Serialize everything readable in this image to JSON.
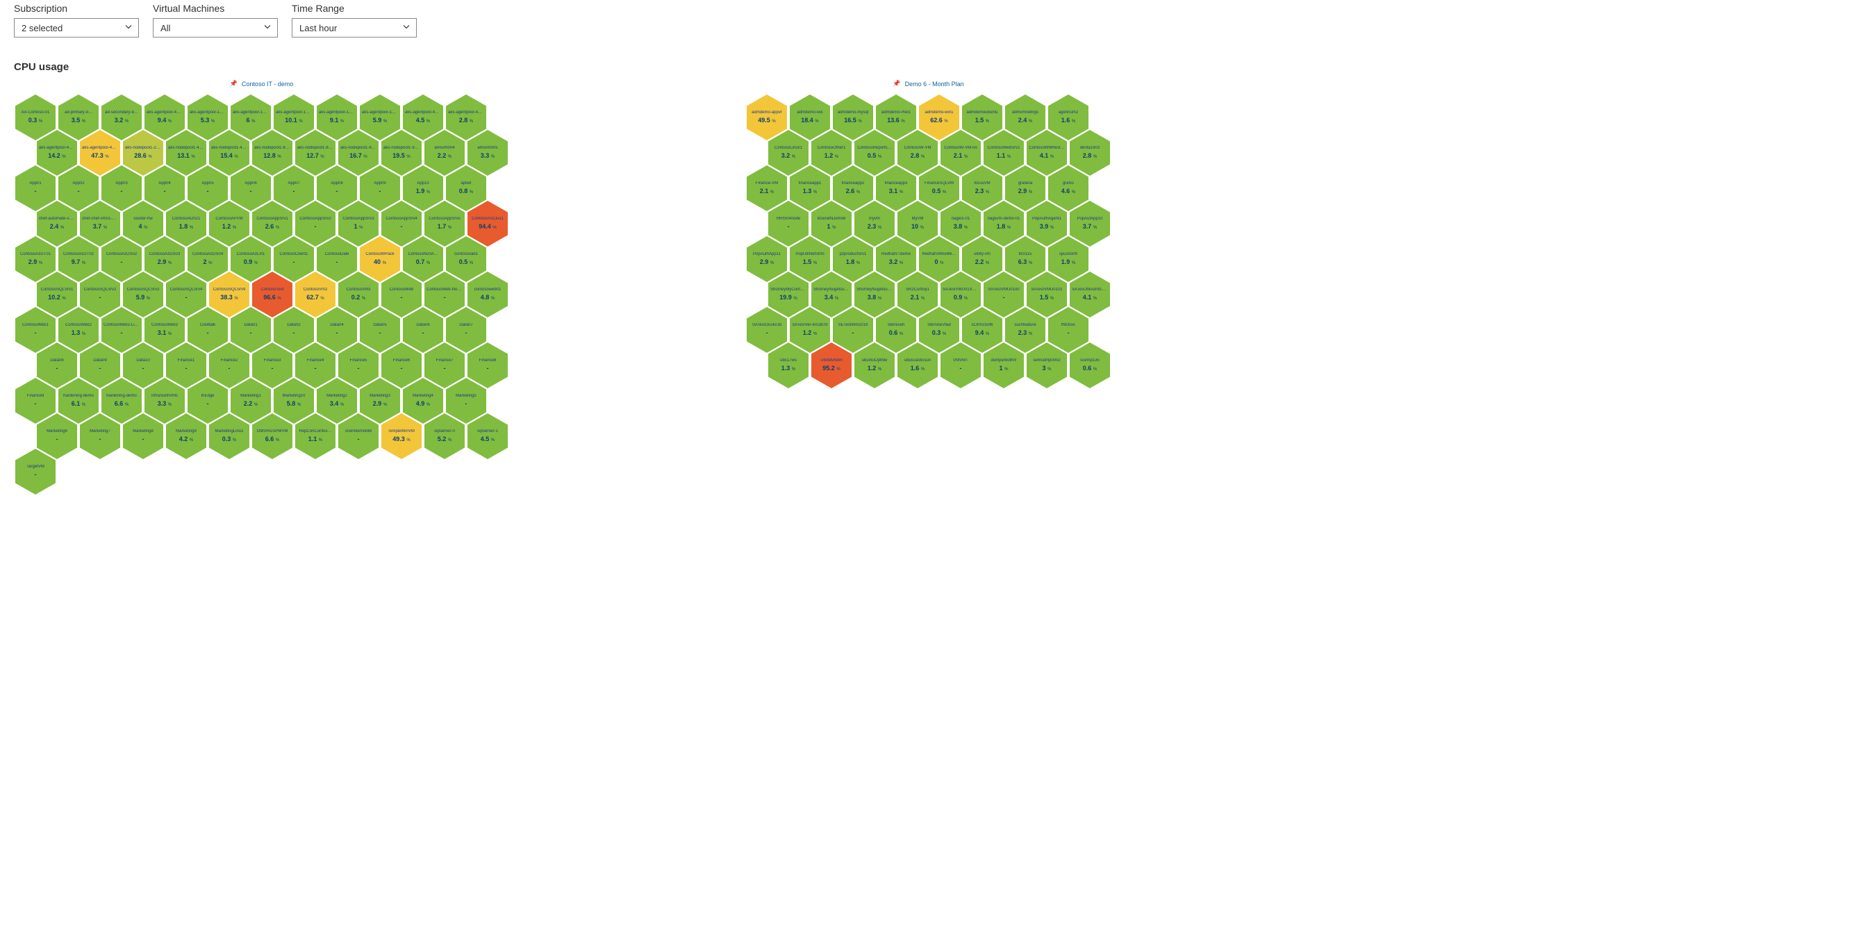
{
  "filters": {
    "subscription": {
      "label": "Subscription",
      "value": "2 selected"
    },
    "vms": {
      "label": "Virtual Machines",
      "value": "All"
    },
    "timerange": {
      "label": "Time Range",
      "value": "Last hour"
    }
  },
  "panel": {
    "title": "CPU usage"
  },
  "thresholds": {
    "green": "#80bc3f",
    "yellow": "#f3c63a",
    "orange": "#e87a2a",
    "red": "#e85b2e"
  },
  "clusters": [
    {
      "title": "Contoso IT - demo",
      "rows": [
        [
          {
            "name": "AA-Contoso-01",
            "value": "0.3"
          },
          {
            "name": "ad-primary-d…",
            "value": "3.5"
          },
          {
            "name": "ad-secondary-d…",
            "value": "3.2"
          },
          {
            "name": "aks-agentpool-40719…",
            "value": "9.4"
          },
          {
            "name": "aks-agentpool-14131…",
            "value": "5.3"
          },
          {
            "name": "aks-agentpool-14132…",
            "value": "6"
          },
          {
            "name": "aks-agentpool-14830…",
            "value": "10.1"
          },
          {
            "name": "aks-agentpool-18040…",
            "value": "9.1"
          },
          {
            "name": "aks-agentpool-18040…",
            "value": "5.9"
          },
          {
            "name": "aks-agentpool-40718…",
            "value": "4.5"
          },
          {
            "name": "aks-agentpool-40718…",
            "value": "2.8"
          }
        ],
        [
          {
            "name": "aks-agentpool-40719…",
            "value": "14.2"
          },
          {
            "name": "aks-agentpool-40719…",
            "value": "47.3",
            "color": "yellow"
          },
          {
            "name": "aks-nodepool1-2549…",
            "value": "28.6"
          },
          {
            "name": "aks-nodepool1-4281…",
            "value": "13.1"
          },
          {
            "name": "aks-nodepool1-4281…",
            "value": "15.4"
          },
          {
            "name": "aks-nodepool1-8538…",
            "value": "12.8"
          },
          {
            "name": "aks-nodepool1-8538…",
            "value": "12.7"
          },
          {
            "name": "aks-nodepool1-8538…",
            "value": "16.7"
          },
          {
            "name": "aks-nodepool1-9520…",
            "value": "19.5"
          },
          {
            "name": "amsvm004",
            "value": "2.2"
          },
          {
            "name": "amsvm005",
            "value": "3.3"
          }
        ],
        [
          {
            "name": "App01",
            "value": null
          },
          {
            "name": "App02",
            "value": null
          },
          {
            "name": "App03",
            "value": null
          },
          {
            "name": "App04",
            "value": null
          },
          {
            "name": "App05",
            "value": null
          },
          {
            "name": "App06",
            "value": null
          },
          {
            "name": "App07",
            "value": null
          },
          {
            "name": "App08",
            "value": null
          },
          {
            "name": "App09",
            "value": null
          },
          {
            "name": "App10",
            "value": "1.9"
          },
          {
            "name": "apted",
            "value": "0.8"
          }
        ],
        [
          {
            "name": "chef-automate-vm01",
            "value": "2.4"
          },
          {
            "name": "chef-chef-vm01-VM",
            "value": "3.7"
          },
          {
            "name": "cluster-hw",
            "value": "4"
          },
          {
            "name": "ContosoAD021",
            "value": "1.8"
          },
          {
            "name": "ContosoAPVM",
            "value": "1.2"
          },
          {
            "name": "ContosoAppSrv1",
            "value": "2.6"
          },
          {
            "name": "ContosoAppSrv2",
            "value": null
          },
          {
            "name": "ContosoAppSrv3",
            "value": "1"
          },
          {
            "name": "ContosoAppSrv4",
            "value": null
          },
          {
            "name": "ContosoAppSrv5",
            "value": "1.7"
          },
          {
            "name": "ContosoASClus1",
            "value": "94.4",
            "color": "red"
          }
        ],
        [
          {
            "name": "ContosoAzDT01",
            "value": "2.9"
          },
          {
            "name": "ContosoAzDT02",
            "value": "9.7"
          },
          {
            "name": "ContosoAzDS02",
            "value": null
          },
          {
            "name": "ContosoAzDS03",
            "value": "2.9"
          },
          {
            "name": "ContosoAzDS04",
            "value": "2"
          },
          {
            "name": "ContosoAzLin1",
            "value": "0.9"
          },
          {
            "name": "ContosoClient1",
            "value": null
          },
          {
            "name": "ContosoDale",
            "value": null
          },
          {
            "name": "ContosoWPack",
            "value": "40",
            "color": "yellow"
          },
          {
            "name": "ContosoNoSn…",
            "value": "0.7"
          },
          {
            "name": "contosovab1",
            "value": "0.5"
          }
        ],
        [
          {
            "name": "ContosoSQLSrv1",
            "value": "10.2"
          },
          {
            "name": "ContosoSQLSrv2",
            "value": null
          },
          {
            "name": "ContosoSQLSrv3",
            "value": "5.9"
          },
          {
            "name": "ContosoSQLSrv4",
            "value": null
          },
          {
            "name": "ContosoSQLSrv9",
            "value": "38.3",
            "color": "yellow"
          },
          {
            "name": "ContosoTest",
            "value": "96.6",
            "color": "red"
          },
          {
            "name": "ContosoVm2",
            "value": "62.7",
            "color": "yellow"
          },
          {
            "name": "ContosoVM3",
            "value": "0.2"
          },
          {
            "name": "ContosoWeb",
            "value": null
          },
          {
            "name": "ContosoWeb-NoState",
            "value": null
          },
          {
            "name": "contosoweb01",
            "value": "4.8"
          }
        ],
        [
          {
            "name": "ContosoWeb1",
            "value": null
          },
          {
            "name": "ContosoWeb2",
            "value": "1.3"
          },
          {
            "name": "ContosoWeb2-Linux",
            "value": null
          },
          {
            "name": "ContosoWeb3",
            "value": "3.1"
          },
          {
            "name": "Cre8talk",
            "value": null
          },
          {
            "name": "Data01",
            "value": null
          },
          {
            "name": "Data02",
            "value": null
          },
          {
            "name": "Data04",
            "value": null
          },
          {
            "name": "Data05",
            "value": null
          },
          {
            "name": "Data06",
            "value": null
          },
          {
            "name": "Data07",
            "value": null
          }
        ],
        [
          {
            "name": "Data08",
            "value": null
          },
          {
            "name": "Data09",
            "value": null
          },
          {
            "name": "Data10",
            "value": null
          },
          {
            "name": "Finance1",
            "value": null
          },
          {
            "name": "Finance2",
            "value": null
          },
          {
            "name": "Finance3",
            "value": null
          },
          {
            "name": "Finance4",
            "value": null
          },
          {
            "name": "Finance5",
            "value": null
          },
          {
            "name": "Finance6",
            "value": null
          },
          {
            "name": "Finance7",
            "value": null
          },
          {
            "name": "Finance8",
            "value": null
          }
        ],
        [
          {
            "name": "Finance9",
            "value": null
          },
          {
            "name": "hardening-demo",
            "value": "6.1"
          },
          {
            "name": "hardening-demo",
            "value": "6.6"
          },
          {
            "name": "InfraSubhVMs",
            "value": "3.3"
          },
          {
            "name": "InEdge",
            "value": null
          },
          {
            "name": "Marketing1",
            "value": "2.2"
          },
          {
            "name": "Marketing10",
            "value": "5.8"
          },
          {
            "name": "Marketing2",
            "value": "3.4"
          },
          {
            "name": "Marketing3",
            "value": "2.9"
          },
          {
            "name": "Marketing4",
            "value": "4.9"
          },
          {
            "name": "Marketing5",
            "value": null
          }
        ],
        [
          {
            "name": "Marketing6",
            "value": null
          },
          {
            "name": "Marketing7",
            "value": null
          },
          {
            "name": "Marketing8",
            "value": null
          },
          {
            "name": "Marketing9",
            "value": "4.2"
          },
          {
            "name": "MarketingLinu1",
            "value": "0.3"
          },
          {
            "name": "OMSRGSPMVM",
            "value": "6.6"
          },
          {
            "name": "RepConContos…",
            "value": "1.1"
          },
          {
            "name": "scemdemoMB",
            "value": null
          },
          {
            "name": "SimpleWinVM",
            "value": "49.3",
            "color": "yellow"
          },
          {
            "name": "sqlserver-0",
            "value": "5.2"
          },
          {
            "name": "sqlserver-1",
            "value": "4.5"
          }
        ],
        [
          {
            "name": "TargetVM",
            "value": null
          }
        ]
      ]
    },
    {
      "title": "Demo 6 - Month Plan",
      "rows": [
        [
          {
            "name": "admdemo-appvr",
            "value": "49.5",
            "color": "yellow"
          },
          {
            "name": "admdemo-iws",
            "value": "18.4"
          },
          {
            "name": "admdemo-mysql",
            "value": "16.5"
          },
          {
            "name": "admdemo-rhel1",
            "value": "13.6"
          },
          {
            "name": "admdemo-win1",
            "value": "62.6",
            "color": "yellow"
          },
          {
            "name": "admdemoubuntu",
            "value": "1.5"
          },
          {
            "name": "admvmredirgs",
            "value": "2.4"
          },
          {
            "name": "agennum2",
            "value": "1.6"
          }
        ],
        [
          {
            "name": "ContosoLinux1",
            "value": "3.2"
          },
          {
            "name": "ContosoOther1",
            "value": "1.2"
          },
          {
            "name": "ContosoReports…",
            "value": "0.5"
          },
          {
            "name": "ContosoW-VM",
            "value": "2.8"
          },
          {
            "name": "ContosoW-VM-no",
            "value": "2.1"
          },
          {
            "name": "ContosoWebSrv1",
            "value": "1.1"
          },
          {
            "name": "ContosoWMRest…",
            "value": "4.1"
          },
          {
            "name": "denta1903",
            "value": "2.8"
          }
        ],
        [
          {
            "name": "Finance-VM",
            "value": "2.1"
          },
          {
            "name": "financeapp1",
            "value": "1.3"
          },
          {
            "name": "financeapp2",
            "value": "2.6"
          },
          {
            "name": "financeapp3",
            "value": "3.1"
          },
          {
            "name": "FinanceSQLVM",
            "value": "0.5"
          },
          {
            "name": "focusVM",
            "value": "2.3"
          },
          {
            "name": "grafana",
            "value": "2.9"
          },
          {
            "name": "grafvs",
            "value": "4.6"
          }
        ],
        [
          {
            "name": "HRIS04node",
            "value": null
          },
          {
            "name": "loserathDemo6",
            "value": "1"
          },
          {
            "name": "myvm",
            "value": "2.3"
          },
          {
            "name": "MyVM",
            "value": "10"
          },
          {
            "name": "nagios-01",
            "value": "3.8"
          },
          {
            "name": "nagsvm-demo-01",
            "value": "1.8"
          },
          {
            "name": "PopAuthAgent1",
            "value": "3.9"
          },
          {
            "name": "PopAutApp10",
            "value": "3.7"
          }
        ],
        [
          {
            "name": "PopAuthApp11",
            "value": "2.9"
          },
          {
            "name": "PopUtilNetStrm",
            "value": "1.5"
          },
          {
            "name": "pzproductSrv1",
            "value": "1.8"
          },
          {
            "name": "RedhatVTdemo",
            "value": "3.2"
          },
          {
            "name": "RedhatVMnoMk…",
            "value": "0"
          },
          {
            "name": "utility-vm",
            "value": "2.2"
          },
          {
            "name": "tls0115",
            "value": "6.3"
          },
          {
            "name": "spusnorth",
            "value": "1.9"
          }
        ],
        [
          {
            "name": "ShorneyMyContos02",
            "value": "19.9"
          },
          {
            "name": "ShorneyNugetsub10",
            "value": "3.4"
          },
          {
            "name": "ShorneyNugetsub18",
            "value": "3.8"
          },
          {
            "name": "SR2Curtioy1",
            "value": "2.1"
          },
          {
            "name": "SATesIVMU01VM…",
            "value": "0.9"
          },
          {
            "name": "SATesIVMU0100",
            "value": null
          },
          {
            "name": "SATesIVMU0101",
            "value": "1.5"
          },
          {
            "name": "SATesUMusInfoD…",
            "value": "4.1"
          }
        ],
        [
          {
            "name": "SATesIOuskv18",
            "value": null
          },
          {
            "name": "SATesIVer-k01BUS",
            "value": "1.2"
          },
          {
            "name": "SETestWin2019",
            "value": null
          },
          {
            "name": "sterniseh",
            "value": "0.6"
          },
          {
            "name": "sterniseVtad",
            "value": "0.3"
          },
          {
            "name": "sClrmsSof6",
            "value": "9.4"
          },
          {
            "name": "suchfeature",
            "value": "2.3"
          },
          {
            "name": "thtctsvc",
            "value": null
          }
        ],
        [
          {
            "name": "ubc17ws",
            "value": "1.3"
          },
          {
            "name": "UbntdvNbm",
            "value": "95.2",
            "color": "red"
          },
          {
            "name": "ubuntuOptNw",
            "value": "1.2"
          },
          {
            "name": "ubuscasticsun",
            "value": "1.6"
          },
          {
            "name": "VMVMT",
            "value": null
          },
          {
            "name": "dumperbothn!",
            "value": "1"
          },
          {
            "name": "semsdmp0002",
            "value": "3"
          },
          {
            "name": "scemp135",
            "value": "0.6"
          }
        ]
      ]
    }
  ]
}
